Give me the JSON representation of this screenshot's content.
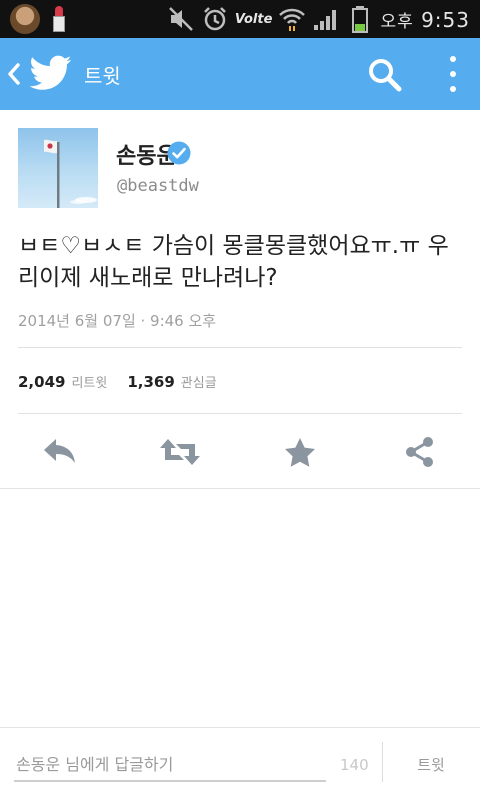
{
  "status_bar": {
    "volte": "Volte",
    "battery_level": 0.35,
    "ampm": "오후",
    "time": "9:53"
  },
  "app_bar": {
    "title": "트윗",
    "color": "#55acee"
  },
  "tweet": {
    "author_name": "손동운",
    "author_handle": "@beastdw",
    "verified": true,
    "text": "ㅂㅌ♡ㅂㅅㅌ 가슴이 몽클몽클했어요ㅠ.ㅠ 우리이제 새노래로 만나려나?",
    "timestamp": "2014년 6월 07일 · 9:46 오후",
    "retweets": {
      "count": "2,049",
      "label": "리트윗"
    },
    "favorites": {
      "count": "1,369",
      "label": "관심글"
    }
  },
  "actions": [
    {
      "name": "reply",
      "icon": "reply-icon"
    },
    {
      "name": "retweet",
      "icon": "retweet-icon"
    },
    {
      "name": "favorite",
      "icon": "star-icon"
    },
    {
      "name": "share",
      "icon": "share-icon"
    }
  ],
  "reply": {
    "placeholder": "손동운 님에게 답글하기",
    "char_count": "140",
    "send_label": "트윗"
  },
  "colors": {
    "accent": "#55acee",
    "action_icon": "#8a95a0",
    "verified": "#55acee"
  }
}
